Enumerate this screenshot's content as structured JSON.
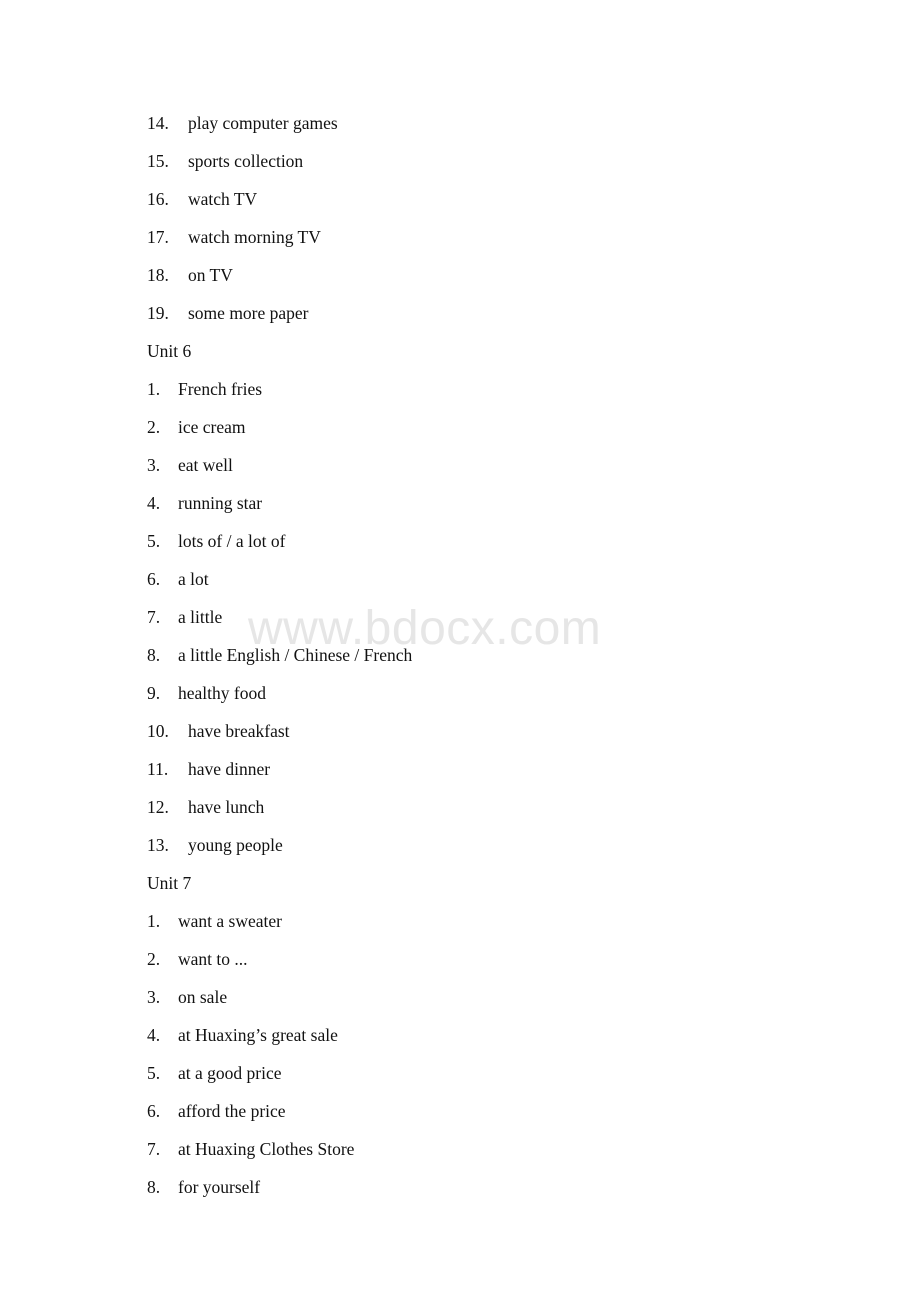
{
  "document": {
    "background_color": "#ffffff",
    "text_color": "#121212"
  },
  "watermark": {
    "text": "www.bdocx.com",
    "color": "#e6e6e6"
  },
  "blocks": [
    {
      "type": "item",
      "number": "14.",
      "text": "play computer games"
    },
    {
      "type": "item",
      "number": "15.",
      "text": "sports collection"
    },
    {
      "type": "item",
      "number": "16.",
      "text": "watch TV"
    },
    {
      "type": "item",
      "number": "17.",
      "text": "watch morning TV"
    },
    {
      "type": "item",
      "number": "18.",
      "text": "on TV"
    },
    {
      "type": "item",
      "number": "19.",
      "text": "some more paper"
    },
    {
      "type": "heading",
      "text": "Unit 6"
    },
    {
      "type": "item",
      "number": "1.",
      "text": "French fries"
    },
    {
      "type": "item",
      "number": "2.",
      "text": "ice cream"
    },
    {
      "type": "item",
      "number": "3.",
      "text": "eat well"
    },
    {
      "type": "item",
      "number": "4.",
      "text": "running star"
    },
    {
      "type": "item",
      "number": "5.",
      "text": "lots of / a lot of"
    },
    {
      "type": "item",
      "number": "6.",
      "text": "a lot"
    },
    {
      "type": "item",
      "number": "7.",
      "text": "a little"
    },
    {
      "type": "item",
      "number": "8.",
      "text": "a little English / Chinese / French"
    },
    {
      "type": "item",
      "number": "9.",
      "text": "healthy food"
    },
    {
      "type": "item",
      "number": "10.",
      "text": "have breakfast"
    },
    {
      "type": "item",
      "number": "11.",
      "text": "have dinner"
    },
    {
      "type": "item",
      "number": "12.",
      "text": "have lunch"
    },
    {
      "type": "item",
      "number": "13.",
      "text": "young people"
    },
    {
      "type": "heading",
      "text": "Unit 7"
    },
    {
      "type": "item",
      "number": "1.",
      "text": "want a sweater"
    },
    {
      "type": "item",
      "number": "2.",
      "text": "want to ..."
    },
    {
      "type": "item",
      "number": "3.",
      "text": "on sale"
    },
    {
      "type": "item",
      "number": "4.",
      "text": "at Huaxing’s great sale"
    },
    {
      "type": "item",
      "number": "5.",
      "text": "at a good price"
    },
    {
      "type": "item",
      "number": "6.",
      "text": "afford the price"
    },
    {
      "type": "item",
      "number": "7.",
      "text": "at Huaxing Clothes Store"
    },
    {
      "type": "item",
      "number": "8.",
      "text": "for yourself"
    }
  ]
}
